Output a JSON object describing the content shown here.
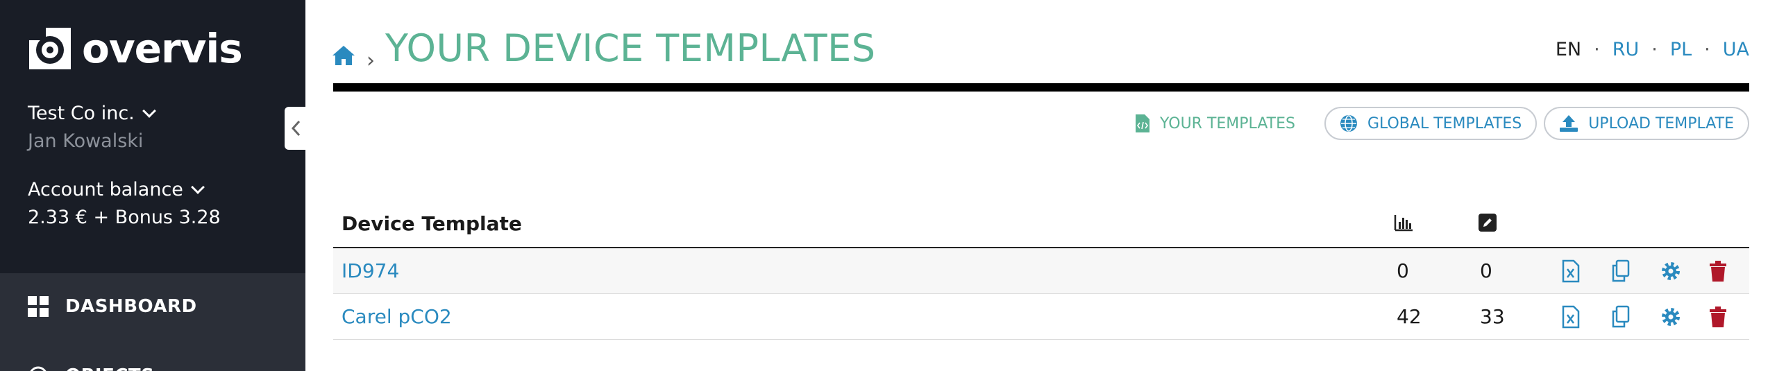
{
  "brand": {
    "name": "overvis"
  },
  "sidebar": {
    "company": "Test Co inc.",
    "user": "Jan Kowalski",
    "balance_label": "Account balance",
    "balance_value": "2.33 € + Bonus 3.28",
    "nav": [
      {
        "label": "DASHBOARD",
        "icon": "dashboard-grid-icon"
      },
      {
        "label": "OBJECTS",
        "icon": "objects-icon"
      }
    ]
  },
  "header": {
    "title": "YOUR DEVICE TEMPLATES",
    "breadcrumb_separator": "›",
    "languages": [
      "EN",
      "RU",
      "PL",
      "UA"
    ],
    "active_language": "EN"
  },
  "tabs": [
    {
      "label": "YOUR TEMPLATES",
      "icon": "file-code-icon"
    },
    {
      "label": "GLOBAL TEMPLATES",
      "icon": "globe-icon"
    },
    {
      "label": "UPLOAD TEMPLATE",
      "icon": "upload-icon"
    }
  ],
  "table": {
    "columns": [
      "Device Template"
    ],
    "column_icons": [
      "bar-chart-icon",
      "edit-icon"
    ],
    "rows": [
      {
        "name": "ID974",
        "v1": "0",
        "v2": "0"
      },
      {
        "name": "Carel pCO2",
        "v1": "42",
        "v2": "33"
      }
    ]
  },
  "colors": {
    "sidebar_bg": "#191d26",
    "accent_green": "#5cb394",
    "link_blue": "#2a8abf",
    "delete_red": "#b0182a"
  }
}
